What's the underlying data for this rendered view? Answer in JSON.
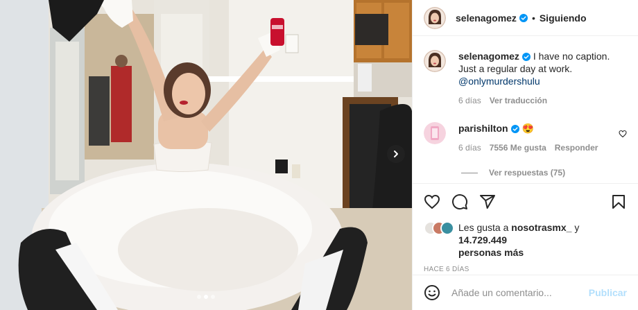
{
  "post": {
    "author": "selenagomez",
    "follow_separator": "•",
    "follow_label": "Siguiendo"
  },
  "caption": {
    "user": "selenagomez",
    "text": "I have no caption. Just a regular day at work.",
    "mention": "@onlymurdershulu",
    "age": "6 días",
    "translate_label": "Ver traducción"
  },
  "comment": {
    "user": "parishilton",
    "emoji": "😍",
    "age": "6 días",
    "likes": "7556 Me gusta",
    "reply_label": "Responder",
    "view_replies": "Ver respuestas (75)"
  },
  "likes": {
    "prefix": "Les gusta a ",
    "liker": "nosotrasmx_",
    "join": " y ",
    "count": "14.729.449",
    "suffix": "personas más"
  },
  "timestamp": "HACE 6 DÍAS",
  "add_comment": {
    "placeholder": "Añade un comentario...",
    "publish_label": "Publicar"
  },
  "carousel": {
    "slides": 3,
    "active": 1
  },
  "icons": {
    "verified": "verified-badge-icon",
    "like": "heart-icon",
    "comment": "comment-bubble-icon",
    "share": "paper-plane-icon",
    "save": "bookmark-icon",
    "emoji": "smiley-icon",
    "next": "chevron-right-icon"
  },
  "colors": {
    "verified": "#0095f6",
    "link": "#00376b",
    "muted": "#8e8e8e",
    "publish_disabled": "#b2dffc"
  }
}
